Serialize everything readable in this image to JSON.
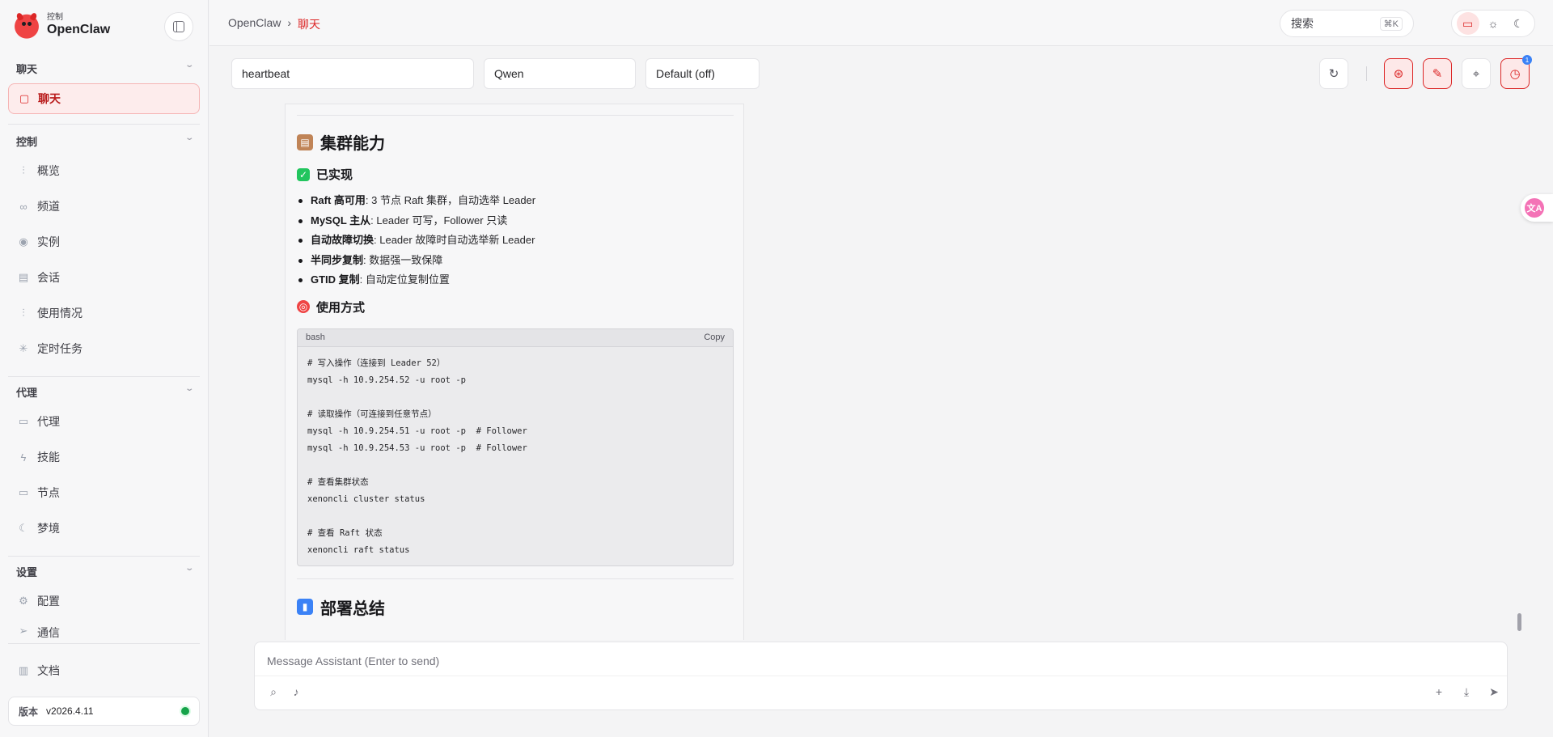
{
  "brand": {
    "sub": "控制",
    "name": "OpenClaw"
  },
  "sidebar": {
    "groups": [
      {
        "title": "聊天",
        "items": [
          {
            "label": "聊天",
            "icon": "message-icon"
          }
        ]
      },
      {
        "title": "控制",
        "items": [
          {
            "label": "概览",
            "icon": "bar-chart-icon"
          },
          {
            "label": "频道",
            "icon": "link-icon"
          },
          {
            "label": "实例",
            "icon": "radio-icon"
          },
          {
            "label": "会话",
            "icon": "file-icon"
          },
          {
            "label": "使用情况",
            "icon": "bar-chart-icon"
          },
          {
            "label": "定时任务",
            "icon": "loader-icon"
          }
        ]
      },
      {
        "title": "代理",
        "items": [
          {
            "label": "代理",
            "icon": "folder-icon"
          },
          {
            "label": "技能",
            "icon": "zap-icon"
          },
          {
            "label": "节点",
            "icon": "monitor-icon"
          },
          {
            "label": "梦境",
            "icon": "moon-icon"
          }
        ]
      },
      {
        "title": "设置",
        "items": [
          {
            "label": "配置",
            "icon": "gear-icon"
          },
          {
            "label": "通信",
            "icon": "send-icon"
          }
        ]
      }
    ],
    "docs": {
      "label": "文档",
      "icon": "book-icon"
    },
    "version": {
      "label": "版本",
      "value": "v2026.4.11",
      "status_color": "#16a34a"
    }
  },
  "topbar": {
    "breadcrumb": [
      "OpenClaw",
      "聊天"
    ],
    "search": {
      "label": "搜索",
      "shortcut": "⌘K"
    }
  },
  "controls": {
    "session": "heartbeat",
    "model": "Qwen",
    "thinking": "Default (off)",
    "cron_badge": "1"
  },
  "message": {
    "section1": {
      "title": "集群能力",
      "icon": "clipboard-icon"
    },
    "implemented": {
      "title": "已实现",
      "icon": "check-box-icon"
    },
    "facts": [
      {
        "bold": "Raft 高可用",
        "text": ": 3 节点 Raft 集群，自动选举 Leader"
      },
      {
        "bold": "MySQL 主从",
        "text": ": Leader 可写，Follower 只读"
      },
      {
        "bold": "自动故障切换",
        "text": ": Leader 故障时自动选举新 Leader"
      },
      {
        "bold": "半同步复制",
        "text": ": 数据强一致保障"
      },
      {
        "bold": "GTID 复制",
        "text": ": 自动定位复制位置"
      }
    ],
    "usage": {
      "title": "使用方式",
      "icon": "target-icon"
    },
    "code": {
      "lang": "bash",
      "copy": "Copy",
      "lines": [
        "# 写入操作（连接到 Leader 52）",
        "mysql -h 10.9.254.52 -u root -p",
        "",
        "# 读取操作（可连接到任意节点）",
        "mysql -h 10.9.254.51 -u root -p  # Follower",
        "mysql -h 10.9.254.53 -u root -p  # Follower",
        "",
        "# 查看集群状态",
        "xenoncli cluster status",
        "",
        "# 查看 Raft 状态",
        "xenoncli raft status"
      ]
    },
    "section2": {
      "title": "部署总结",
      "icon": "bar-chart-emoji-icon"
    }
  },
  "composer": {
    "placeholder": "Message Assistant (Enter to send)"
  },
  "colors": {
    "accent": "#dc2626",
    "accent_bg": "#fdecec"
  }
}
